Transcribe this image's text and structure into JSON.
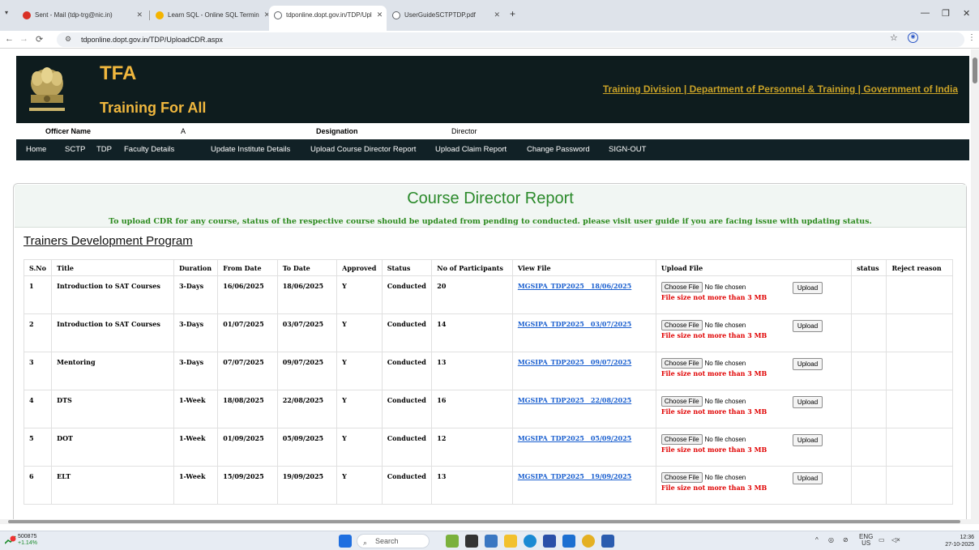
{
  "browser": {
    "tabs": [
      {
        "title": "Sent - Mail (tdp-trg@nic.in)",
        "color": "#d93025"
      },
      {
        "title": "Learn SQL - Online SQL Termin",
        "color": "#f4b400"
      },
      {
        "title": "tdponline.dopt.gov.in/TDP/Upl",
        "color": "#5f6368"
      },
      {
        "title": "UserGuideSCTPTDP.pdf",
        "color": "#5f6368"
      }
    ],
    "url": "tdponline.dopt.gov.in/TDP/UploadCDR.aspx"
  },
  "header": {
    "title": "TFA",
    "subtitle": "Training For All",
    "division": "Training Division | Department of Personnel & Training | Government of India"
  },
  "officer": {
    "name_label": "Officer Name",
    "name_value": "A",
    "designation_label": "Designation",
    "designation_value": "Director"
  },
  "nav": {
    "items": [
      "Home",
      "SCTP",
      "TDP",
      "Faculty Details",
      "Update Institute Details",
      "Upload Course Director Report",
      "Upload Claim Report",
      "Change Password",
      "SIGN-OUT"
    ]
  },
  "report": {
    "title": "Course Director Report",
    "note": "To upload CDR for any course, status of the respective course should be updated from pending to conducted. please visit user guide if you are facing issue with updating status.",
    "program": "Trainers Development Program",
    "columns": [
      "S.No",
      "Title",
      "Duration",
      "From Date",
      "To Date",
      "Approved",
      "Status",
      "No of Participants",
      "View File",
      "Upload File",
      "status",
      "Reject reason"
    ],
    "rows": [
      {
        "sno": "1",
        "title": "Introduction to SAT Courses",
        "duration": "3-Days",
        "from": "16/06/2025",
        "to": "18/06/2025",
        "approved": "Y",
        "status": "Conducted",
        "participants": "20",
        "file": "MGSIPA_TDP2025__18/06/2025"
      },
      {
        "sno": "2",
        "title": "Introduction to SAT Courses",
        "duration": "3-Days",
        "from": "01/07/2025",
        "to": "03/07/2025",
        "approved": "Y",
        "status": "Conducted",
        "participants": "14",
        "file": "MGSIPA_TDP2025__03/07/2025"
      },
      {
        "sno": "3",
        "title": "Mentoring",
        "duration": "3-Days",
        "from": "07/07/2025",
        "to": "09/07/2025",
        "approved": "Y",
        "status": "Conducted",
        "participants": "13",
        "file": "MGSIPA_TDP2025__09/07/2025"
      },
      {
        "sno": "4",
        "title": "DTS",
        "duration": "1-Week",
        "from": "18/08/2025",
        "to": "22/08/2025",
        "approved": "Y",
        "status": "Conducted",
        "participants": "16",
        "file": "MGSIPA_TDP2025__22/08/2025"
      },
      {
        "sno": "5",
        "title": "DOT",
        "duration": "1-Week",
        "from": "01/09/2025",
        "to": "05/09/2025",
        "approved": "Y",
        "status": "Conducted",
        "participants": "12",
        "file": "MGSIPA_TDP2025__05/09/2025"
      },
      {
        "sno": "6",
        "title": "ELT",
        "duration": "1-Week",
        "from": "15/09/2025",
        "to": "19/09/2025",
        "approved": "Y",
        "status": "Conducted",
        "participants": "13",
        "file": "MGSIPA_TDP2025__19/09/2025"
      }
    ],
    "choose_label": "Choose File",
    "no_file": "No file chosen",
    "size_hint": "File size not more than 3 MB",
    "upload_label": "Upload"
  },
  "taskbar": {
    "stock_name": "500875",
    "stock_change": "+1.14%",
    "search": "Search",
    "lang": "ENG",
    "region": "US",
    "time": "12:36",
    "date": "27-10-2025"
  }
}
